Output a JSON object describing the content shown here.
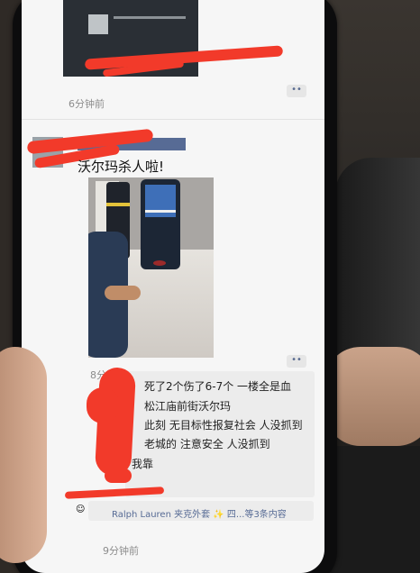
{
  "feed": {
    "post1_time": "6分钟前",
    "post2_text": "沃尔玛杀人啦!",
    "post2_time": "8分钟前",
    "comments": [
      "死了2个伤了6-7个 一楼全是血",
      "松江庙前街沃尔玛",
      "此刻 无目标性报复社会 人没抓到",
      "老城的 注意安全 人没抓到",
      "我靠"
    ],
    "like_line": "Ralph Lauren 夹克外套 ✨ 四...等3条内容",
    "post3_time": "9分钟前",
    "more_icon": "••"
  },
  "colors": {
    "accent_link": "#576b95",
    "redaction": "#f23a2a"
  }
}
